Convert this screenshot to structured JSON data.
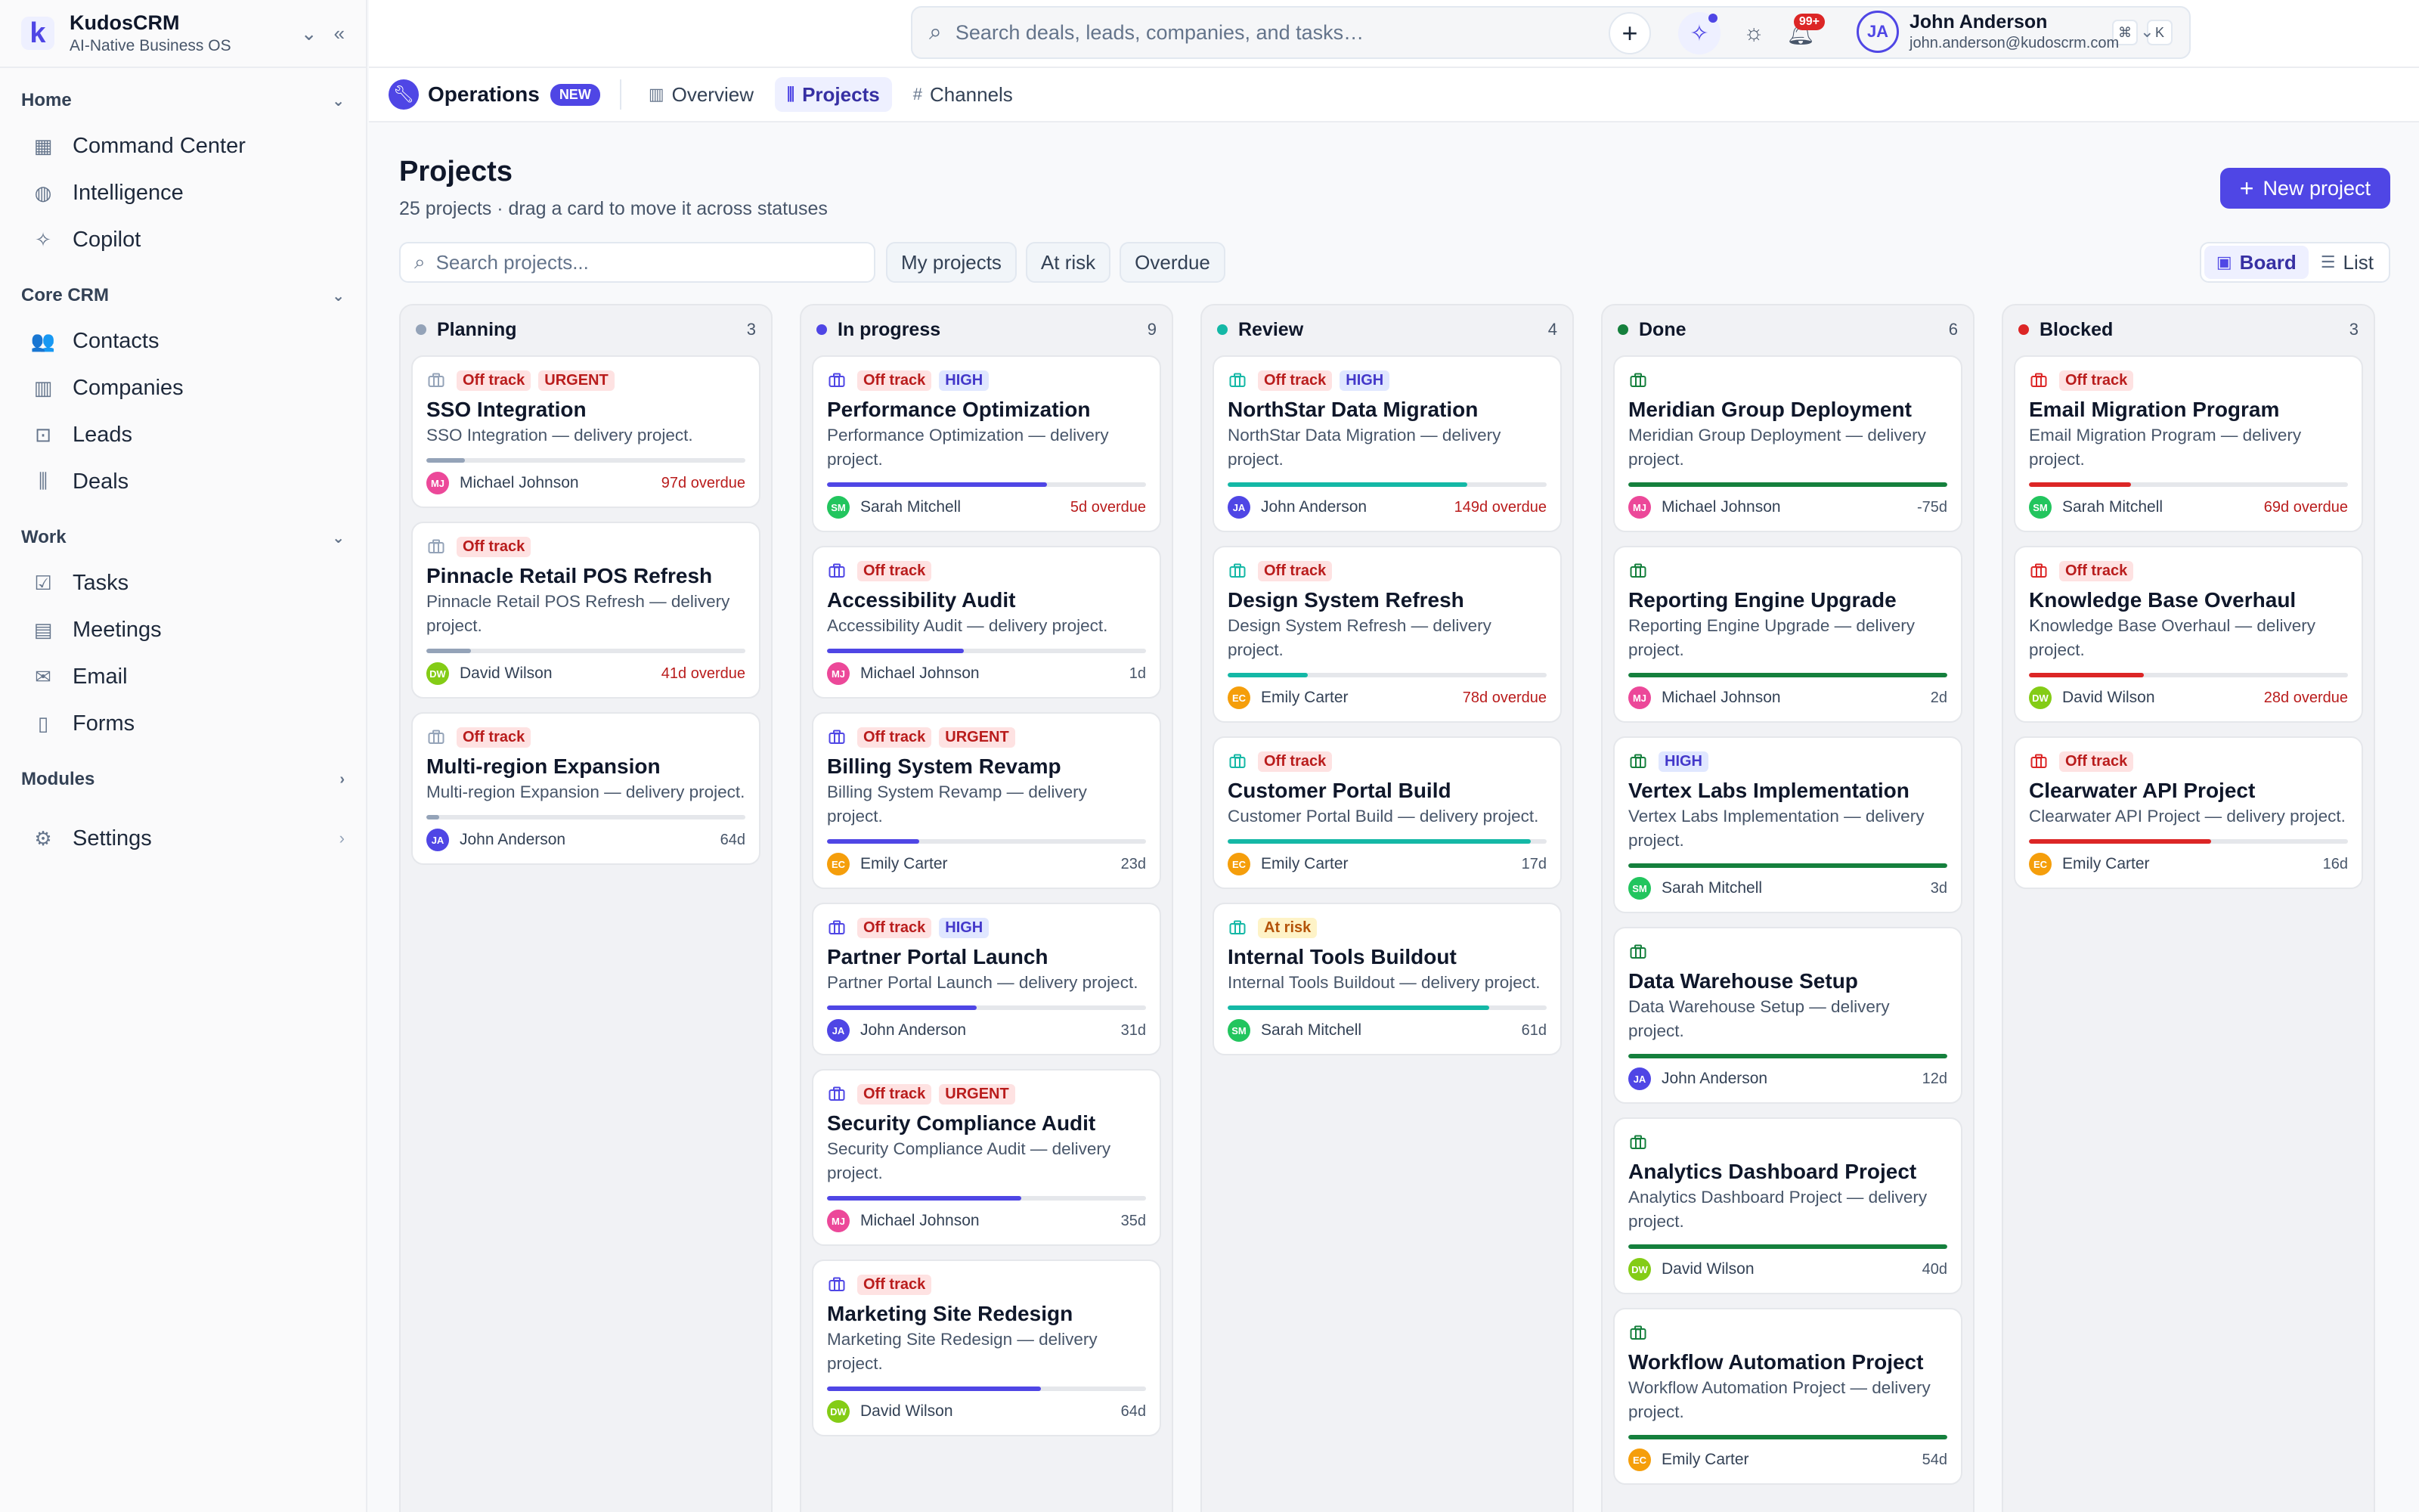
{
  "app": {
    "name": "KudosCRM",
    "tagline": "AI-Native Business OS"
  },
  "sidebar": {
    "sections": [
      {
        "title": "Home",
        "items": [
          {
            "label": "Command Center",
            "icon": "grid-icon",
            "glyph": "▦"
          },
          {
            "label": "Intelligence",
            "icon": "brain-icon",
            "glyph": "◍"
          },
          {
            "label": "Copilot",
            "icon": "sparkle-icon",
            "glyph": "✧"
          }
        ]
      },
      {
        "title": "Core CRM",
        "items": [
          {
            "label": "Contacts",
            "icon": "users-icon",
            "glyph": "👥"
          },
          {
            "label": "Companies",
            "icon": "building-icon",
            "glyph": "▥"
          },
          {
            "label": "Leads",
            "icon": "inbox-icon",
            "glyph": "⊡"
          },
          {
            "label": "Deals",
            "icon": "kanban-icon",
            "glyph": "⫼"
          }
        ]
      },
      {
        "title": "Work",
        "items": [
          {
            "label": "Tasks",
            "icon": "check-square-icon",
            "glyph": "☑"
          },
          {
            "label": "Meetings",
            "icon": "calendar-icon",
            "glyph": "▤"
          },
          {
            "label": "Email",
            "icon": "mail-icon",
            "glyph": "✉"
          },
          {
            "label": "Forms",
            "icon": "file-icon",
            "glyph": "▯"
          }
        ]
      }
    ],
    "modules_label": "Modules",
    "settings_label": "Settings"
  },
  "topbar": {
    "search_placeholder": "Search deals, leads, companies, and tasks…",
    "kbd": [
      "⌘",
      "K"
    ],
    "notif_count": "99+",
    "user": {
      "initials": "JA",
      "name": "John Anderson",
      "email": "john.anderson@kudoscrm.com"
    }
  },
  "subnav": {
    "title": "Operations",
    "badge": "NEW",
    "tabs": [
      {
        "label": "Overview",
        "icon": "building-icon",
        "glyph": "▥",
        "active": false
      },
      {
        "label": "Projects",
        "icon": "kanban-icon",
        "glyph": "⫼",
        "active": true
      },
      {
        "label": "Channels",
        "icon": "hash-icon",
        "glyph": "#",
        "active": false
      }
    ]
  },
  "page": {
    "title": "Projects",
    "subtitle": "25 projects · drag a card to move it across statuses",
    "new_button": "New project",
    "search_placeholder": "Search projects...",
    "filters": [
      "My projects",
      "At risk",
      "Overdue"
    ],
    "views": [
      {
        "label": "Board",
        "active": true
      },
      {
        "label": "List",
        "active": false
      }
    ]
  },
  "colors": {
    "accent": "#4f46e5",
    "planning": "#94a3b8",
    "in_progress": "#4f46e5",
    "review": "#14b8a6",
    "done": "#15803d",
    "blocked": "#dc2626"
  },
  "avatars": {
    "MJ": "#ec4899",
    "DW": "#84cc16",
    "JA": "#4f46e5",
    "SM": "#22c55e",
    "EC": "#f59e0b"
  },
  "columns": [
    {
      "name": "Planning",
      "count": "3",
      "color": "#94a3b8",
      "cards": [
        {
          "status": "Off track",
          "priority": "URGENT",
          "title": "SSO Integration",
          "desc": "SSO Integration — delivery project.",
          "progress": 0.12,
          "initials": "MJ",
          "owner": "Michael Johnson",
          "due": "97d overdue",
          "overdue": true
        },
        {
          "status": "Off track",
          "priority": "",
          "title": "Pinnacle Retail POS Refresh",
          "desc": "Pinnacle Retail POS Refresh — delivery project.",
          "progress": 0.14,
          "initials": "DW",
          "owner": "David Wilson",
          "due": "41d overdue",
          "overdue": true
        },
        {
          "status": "Off track",
          "priority": "",
          "title": "Multi-region Expansion",
          "desc": "Multi-region Expansion — delivery project.",
          "progress": 0.04,
          "initials": "JA",
          "owner": "John Anderson",
          "due": "64d",
          "overdue": false
        }
      ]
    },
    {
      "name": "In progress",
      "count": "9",
      "color": "#4f46e5",
      "cards": [
        {
          "status": "Off track",
          "priority": "HIGH",
          "title": "Performance Optimization",
          "desc": "Performance Optimization — delivery project.",
          "progress": 0.69,
          "initials": "SM",
          "owner": "Sarah Mitchell",
          "due": "5d overdue",
          "overdue": true
        },
        {
          "status": "Off track",
          "priority": "",
          "title": "Accessibility Audit",
          "desc": "Accessibility Audit — delivery project.",
          "progress": 0.43,
          "initials": "MJ",
          "owner": "Michael Johnson",
          "due": "1d",
          "overdue": false
        },
        {
          "status": "Off track",
          "priority": "URGENT",
          "title": "Billing System Revamp",
          "desc": "Billing System Revamp — delivery project.",
          "progress": 0.29,
          "initials": "EC",
          "owner": "Emily Carter",
          "due": "23d",
          "overdue": false
        },
        {
          "status": "Off track",
          "priority": "HIGH",
          "title": "Partner Portal Launch",
          "desc": "Partner Portal Launch — delivery project.",
          "progress": 0.47,
          "initials": "JA",
          "owner": "John Anderson",
          "due": "31d",
          "overdue": false
        },
        {
          "status": "Off track",
          "priority": "URGENT",
          "title": "Security Compliance Audit",
          "desc": "Security Compliance Audit — delivery project.",
          "progress": 0.61,
          "initials": "MJ",
          "owner": "Michael Johnson",
          "due": "35d",
          "overdue": false
        },
        {
          "status": "Off track",
          "priority": "",
          "title": "Marketing Site Redesign",
          "desc": "Marketing Site Redesign — delivery project.",
          "progress": 0.67,
          "initials": "DW",
          "owner": "David Wilson",
          "due": "64d",
          "overdue": false
        }
      ]
    },
    {
      "name": "Review",
      "count": "4",
      "color": "#14b8a6",
      "cards": [
        {
          "status": "Off track",
          "priority": "HIGH",
          "title": "NorthStar Data Migration",
          "desc": "NorthStar Data Migration — delivery project.",
          "progress": 0.75,
          "initials": "JA",
          "owner": "John Anderson",
          "due": "149d overdue",
          "overdue": true
        },
        {
          "status": "Off track",
          "priority": "",
          "title": "Design System Refresh",
          "desc": "Design System Refresh — delivery project.",
          "progress": 0.25,
          "initials": "EC",
          "owner": "Emily Carter",
          "due": "78d overdue",
          "overdue": true
        },
        {
          "status": "Off track",
          "priority": "",
          "title": "Customer Portal Build",
          "desc": "Customer Portal Build — delivery project.",
          "progress": 0.95,
          "initials": "EC",
          "owner": "Emily Carter",
          "due": "17d",
          "overdue": false
        },
        {
          "status": "At risk",
          "priority": "",
          "title": "Internal Tools Buildout",
          "desc": "Internal Tools Buildout — delivery project.",
          "progress": 0.82,
          "initials": "SM",
          "owner": "Sarah Mitchell",
          "due": "61d",
          "overdue": false
        }
      ]
    },
    {
      "name": "Done",
      "count": "6",
      "color": "#15803d",
      "cards": [
        {
          "status": "",
          "priority": "",
          "title": "Meridian Group Deployment",
          "desc": "Meridian Group Deployment — delivery project.",
          "progress": 1,
          "initials": "MJ",
          "owner": "Michael Johnson",
          "due": "-75d",
          "overdue": false
        },
        {
          "status": "",
          "priority": "",
          "title": "Reporting Engine Upgrade",
          "desc": "Reporting Engine Upgrade — delivery project.",
          "progress": 1,
          "initials": "MJ",
          "owner": "Michael Johnson",
          "due": "2d",
          "overdue": false
        },
        {
          "status": "",
          "priority": "HIGH",
          "title": "Vertex Labs Implementation",
          "desc": "Vertex Labs Implementation — delivery project.",
          "progress": 1,
          "initials": "SM",
          "owner": "Sarah Mitchell",
          "due": "3d",
          "overdue": false
        },
        {
          "status": "",
          "priority": "",
          "title": "Data Warehouse Setup",
          "desc": "Data Warehouse Setup — delivery project.",
          "progress": 1,
          "initials": "JA",
          "owner": "John Anderson",
          "due": "12d",
          "overdue": false
        },
        {
          "status": "",
          "priority": "",
          "title": "Analytics Dashboard Project",
          "desc": "Analytics Dashboard Project — delivery project.",
          "progress": 1,
          "initials": "DW",
          "owner": "David Wilson",
          "due": "40d",
          "overdue": false
        },
        {
          "status": "",
          "priority": "",
          "title": "Workflow Automation Project",
          "desc": "Workflow Automation Project — delivery project.",
          "progress": 1,
          "initials": "EC",
          "owner": "Emily Carter",
          "due": "54d",
          "overdue": false
        }
      ]
    },
    {
      "name": "Blocked",
      "count": "3",
      "color": "#dc2626",
      "cards": [
        {
          "status": "Off track",
          "priority": "",
          "title": "Email Migration Program",
          "desc": "Email Migration Program — delivery project.",
          "progress": 0.32,
          "initials": "SM",
          "owner": "Sarah Mitchell",
          "due": "69d overdue",
          "overdue": true
        },
        {
          "status": "Off track",
          "priority": "",
          "title": "Knowledge Base Overhaul",
          "desc": "Knowledge Base Overhaul — delivery project.",
          "progress": 0.36,
          "initials": "DW",
          "owner": "David Wilson",
          "due": "28d overdue",
          "overdue": true
        },
        {
          "status": "Off track",
          "priority": "",
          "title": "Clearwater API Project",
          "desc": "Clearwater API Project — delivery project.",
          "progress": 0.57,
          "initials": "EC",
          "owner": "Emily Carter",
          "due": "16d",
          "overdue": false
        }
      ]
    }
  ]
}
